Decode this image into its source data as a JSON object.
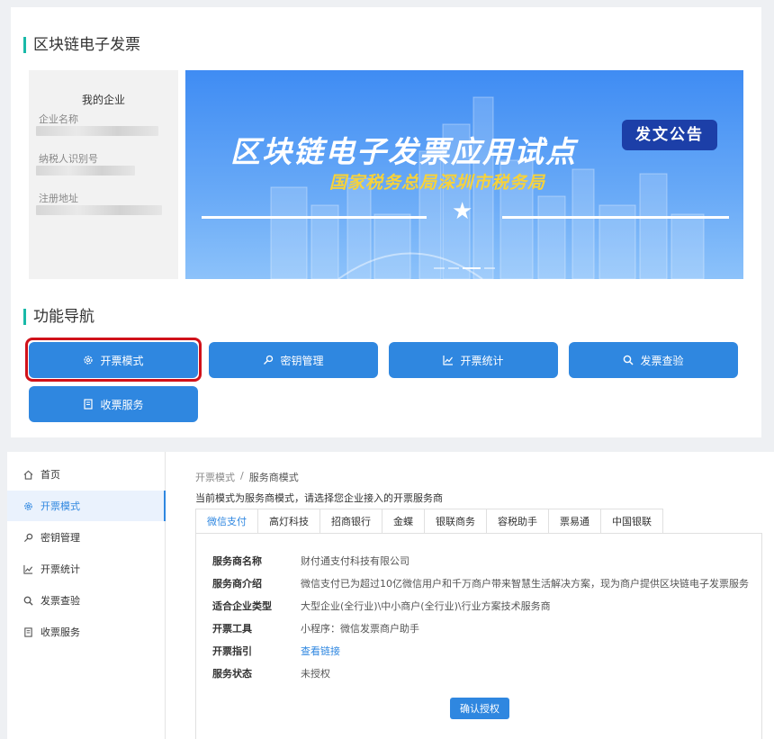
{
  "top": {
    "title": "区块链电子发票",
    "company": {
      "title": "我的企业",
      "fields": [
        {
          "label": "企业名称"
        },
        {
          "label": "纳税人识别号"
        },
        {
          "label": "注册地址"
        }
      ]
    },
    "banner": {
      "title": "区块链电子发票应用试点",
      "subtitle": "国家税务总局深圳市税务局",
      "notice": "发文公告"
    },
    "nav_title": "功能导航",
    "nav_buttons": [
      {
        "label": "开票模式",
        "icon": "gear-icon"
      },
      {
        "label": "密钥管理",
        "icon": "key-icon"
      },
      {
        "label": "开票统计",
        "icon": "chart-icon"
      },
      {
        "label": "发票查验",
        "icon": "search-icon"
      },
      {
        "label": "收票服务",
        "icon": "receipt-icon"
      }
    ]
  },
  "sidebar": {
    "items": [
      {
        "label": "首页",
        "icon": "home-icon"
      },
      {
        "label": "开票模式",
        "icon": "gear-icon",
        "active": true
      },
      {
        "label": "密钥管理",
        "icon": "key-icon"
      },
      {
        "label": "开票统计",
        "icon": "chart-icon"
      },
      {
        "label": "发票查验",
        "icon": "search-icon"
      },
      {
        "label": "收票服务",
        "icon": "receipt-icon"
      }
    ]
  },
  "main": {
    "breadcrumb": {
      "parent": "开票模式",
      "sep": "/",
      "current": "服务商模式"
    },
    "hint": "当前模式为服务商模式，请选择您企业接入的开票服务商",
    "tabs": [
      "微信支付",
      "高灯科技",
      "招商银行",
      "金蝶",
      "银联商务",
      "税助手",
      "票易通",
      "中国银联"
    ],
    "tabs_display": [
      "微信支付",
      "高灯科技",
      "招商银行",
      "金蝶",
      "银联商务",
      "容税助手",
      "票易通",
      "中国银联"
    ],
    "active_tab": 0,
    "info": [
      {
        "key": "服务商名称",
        "value": "财付通支付科技有限公司"
      },
      {
        "key": "服务商介绍",
        "value": "微信支付已为超过10亿微信用户和千万商户带来智慧生活解决方案，现为商户提供区块链电子发票服务"
      },
      {
        "key": "适合企业类型",
        "value": "大型企业(全行业)\\中小商户(全行业)\\行业方案技术服务商"
      },
      {
        "key": "开票工具",
        "value": "小程序：微信发票商户助手"
      },
      {
        "key": "开票指引",
        "value": "查看链接"
      },
      {
        "key": "服务状态",
        "value": "未授权"
      }
    ],
    "confirm_label": "确认授权"
  },
  "colors": {
    "primary": "#2f87e0",
    "accent_bar": "#19b9a8",
    "highlight": "#d0111a",
    "notice_bg": "#1c3fa8",
    "subtitle": "#f7d23a"
  }
}
